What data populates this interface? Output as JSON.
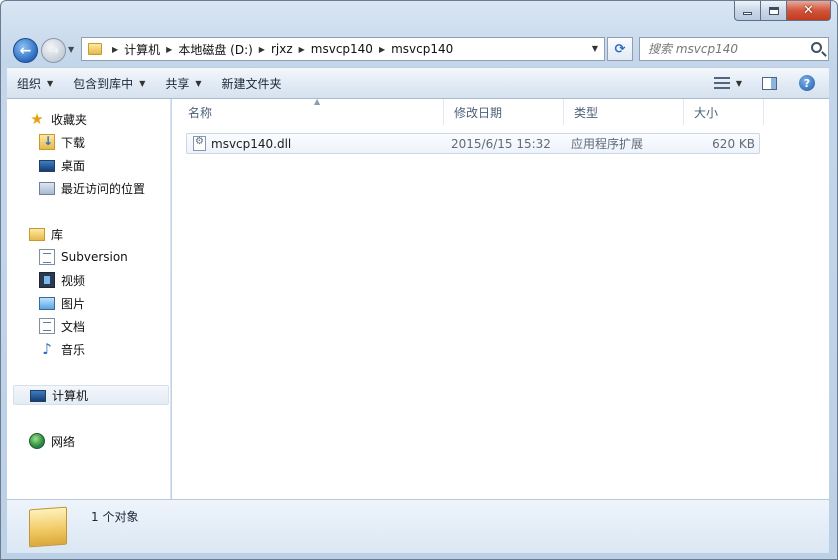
{
  "address": {
    "crumbs": [
      "计算机",
      "本地磁盘 (D:)",
      "rjxz",
      "msvcp140",
      "msvcp140"
    ]
  },
  "search": {
    "placeholder": "搜索 msvcp140"
  },
  "toolbar": {
    "organize": "组织",
    "include_in_library": "包含到库中",
    "share": "共享",
    "new_folder": "新建文件夹"
  },
  "nav": {
    "favorites": "收藏夹",
    "downloads": "下载",
    "desktop": "桌面",
    "recent": "最近访问的位置",
    "libraries": "库",
    "subversion": "Subversion",
    "videos": "视频",
    "pictures": "图片",
    "documents": "文档",
    "music": "音乐",
    "computer": "计算机",
    "network": "网络"
  },
  "columns": {
    "name": "名称",
    "modified": "修改日期",
    "type": "类型",
    "size": "大小"
  },
  "files": [
    {
      "name": "msvcp140.dll",
      "modified": "2015/6/15 15:32",
      "type": "应用程序扩展",
      "size": "620 KB"
    }
  ],
  "details": {
    "count": "1 个对象"
  },
  "icons": {
    "back": "back-arrow-icon",
    "forward": "forward-arrow-icon",
    "refresh": "refresh-icon",
    "search": "search-icon",
    "help": "help-icon"
  }
}
